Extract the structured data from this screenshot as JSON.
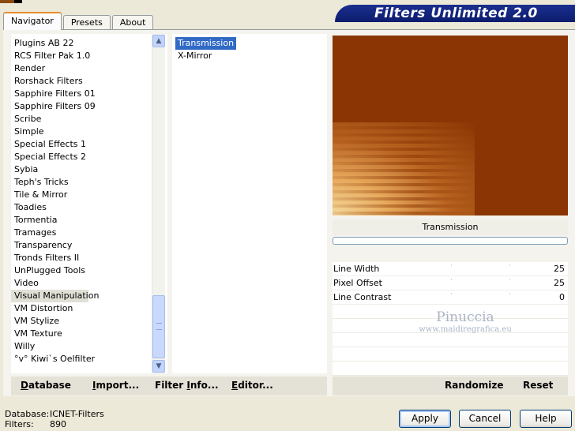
{
  "tabs": [
    {
      "label": "Navigator",
      "active": true
    },
    {
      "label": "Presets",
      "active": false
    },
    {
      "label": "About",
      "active": false
    }
  ],
  "brand": "Filters Unlimited 2.0",
  "categories": [
    "Plugins AB 22",
    "RCS Filter Pak 1.0",
    "Render",
    "Rorshack Filters",
    "Sapphire Filters 01",
    "Sapphire Filters 09",
    "Scribe",
    "Simple",
    "Special Effects 1",
    "Special Effects 2",
    "Sybia",
    "Teph's Tricks",
    "Tile & Mirror",
    "Toadies",
    "Tormentia",
    "Tramages",
    "Transparency",
    "Tronds Filters II",
    "UnPlugged Tools",
    "Video",
    "Visual Manipulation",
    "VM Distortion",
    "VM Stylize",
    "VM Texture",
    "Willy",
    "°v° Kiwi`s Oelfilter"
  ],
  "selected_category": "Visual Manipulation",
  "filters": [
    "Transmission",
    "X-Mirror"
  ],
  "selected_filter": "Transmission",
  "current_filter_label": "Transmission",
  "params": [
    {
      "name": "Line Width",
      "value": "25"
    },
    {
      "name": "Pixel Offset",
      "value": "25"
    },
    {
      "name": "Line Contrast",
      "value": "0"
    }
  ],
  "watermark": {
    "line1": "Pinuccia",
    "line2": "www.maidiregrafica.eu"
  },
  "left_buttons": {
    "database": {
      "underline": "D",
      "rest": "atabase"
    },
    "import": {
      "underline": "I",
      "rest": "mport..."
    },
    "filter_info": {
      "before": "Filter ",
      "underline": "I",
      "rest": "nfo..."
    },
    "editor": {
      "underline": "E",
      "rest": "ditor..."
    }
  },
  "right_buttons": {
    "randomize": "Randomize",
    "reset": "Reset"
  },
  "footer": {
    "database_label": "Database:",
    "database_value": "ICNET-Filters",
    "filters_label": "Filters:",
    "filters_value": "890"
  },
  "dialog_buttons": {
    "apply": "Apply",
    "cancel": "Cancel",
    "help": "Help"
  },
  "colors": {
    "preview_base": "#8a3503",
    "selection": "#316ac5",
    "brand_bg": "#1b2f8e"
  }
}
